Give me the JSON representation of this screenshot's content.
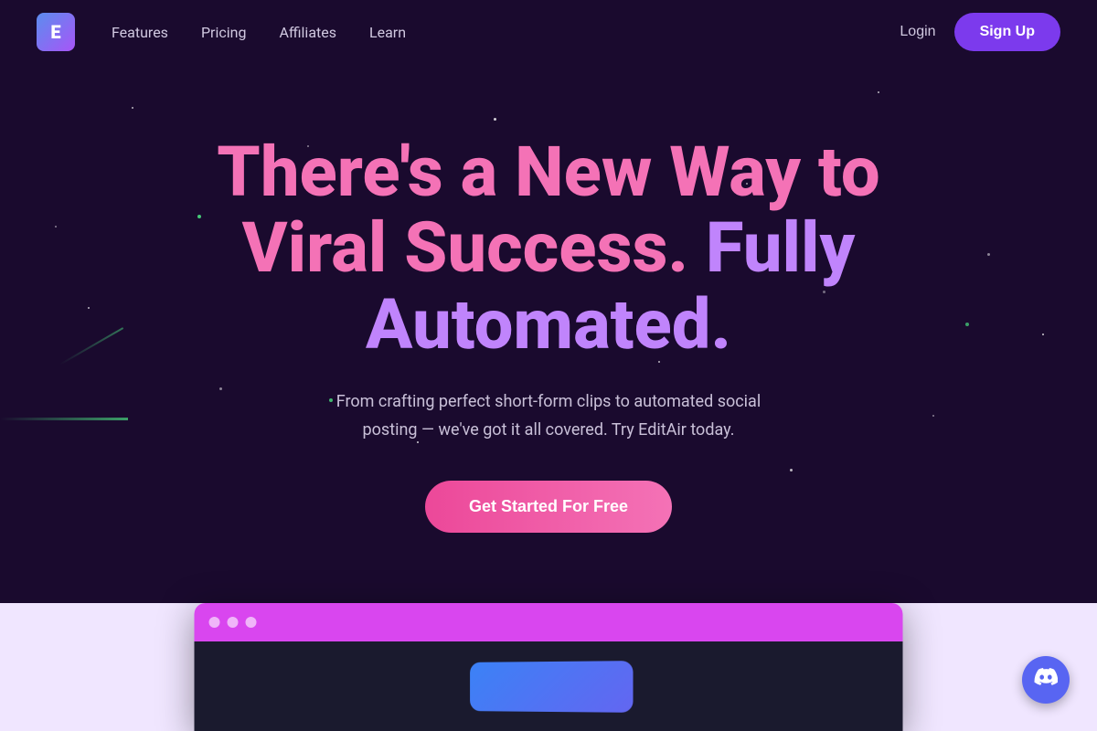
{
  "navbar": {
    "logo_text": "E",
    "links": [
      {
        "label": "Features",
        "id": "features"
      },
      {
        "label": "Pricing",
        "id": "pricing"
      },
      {
        "label": "Affiliates",
        "id": "affiliates"
      },
      {
        "label": "Learn",
        "id": "learn"
      }
    ],
    "login_label": "Login",
    "signup_label": "Sign Up"
  },
  "hero": {
    "title_line1": "There's a New Way to",
    "title_line2_pink": "Viral Success.",
    "title_line2_purple": " Fully",
    "title_line3": "Automated.",
    "subtitle": "From crafting perfect short-form clips to automated social posting — we've got it all covered. Try EditAir today.",
    "cta_label": "Get Started For Free"
  },
  "window": {
    "dots": [
      "●",
      "●",
      "●"
    ]
  },
  "discord": {
    "icon": "💬"
  },
  "colors": {
    "bg": "#1a0a2e",
    "accent_purple": "#7c3aed",
    "accent_pink": "#f472b6",
    "accent_green": "#4ade80"
  }
}
